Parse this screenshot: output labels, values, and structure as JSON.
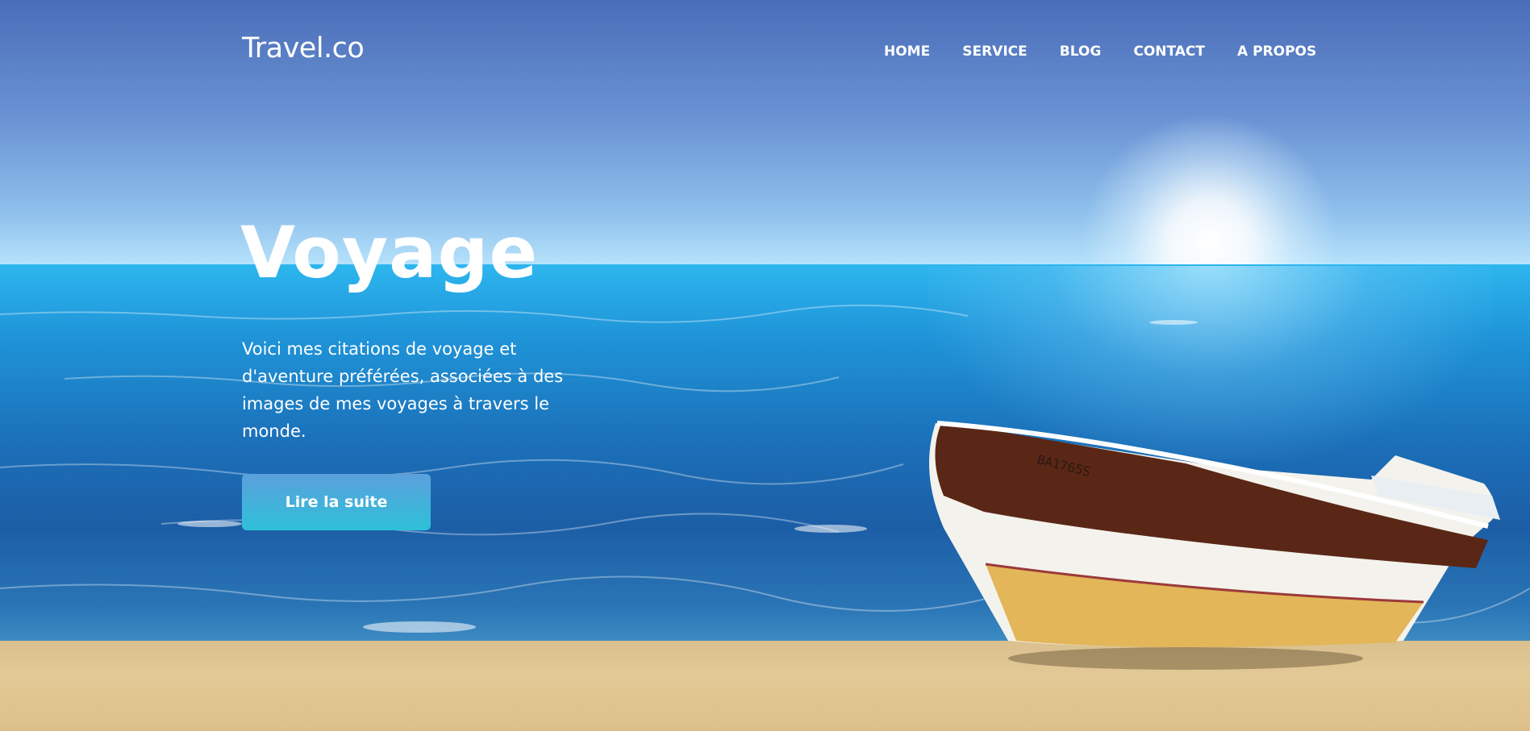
{
  "brand": {
    "logo_text": "Travel.co"
  },
  "nav": {
    "items": [
      {
        "label": "HOME"
      },
      {
        "label": "SERVICE"
      },
      {
        "label": "BLOG"
      },
      {
        "label": "CONTACT"
      },
      {
        "label": "A PROPOS"
      }
    ]
  },
  "hero": {
    "title": "Voyage",
    "description": "Voici mes citations de voyage et d'aventure préférées, associées à des images de mes voyages à travers le monde.",
    "cta_label": "Lire la suite"
  },
  "colors": {
    "sky": "#5b83c8",
    "sea": "#1f6fb8",
    "sand": "#e0c592",
    "cta_start": "#5ba0dc",
    "cta_end": "#2ec0d8",
    "text": "#ffffff"
  }
}
